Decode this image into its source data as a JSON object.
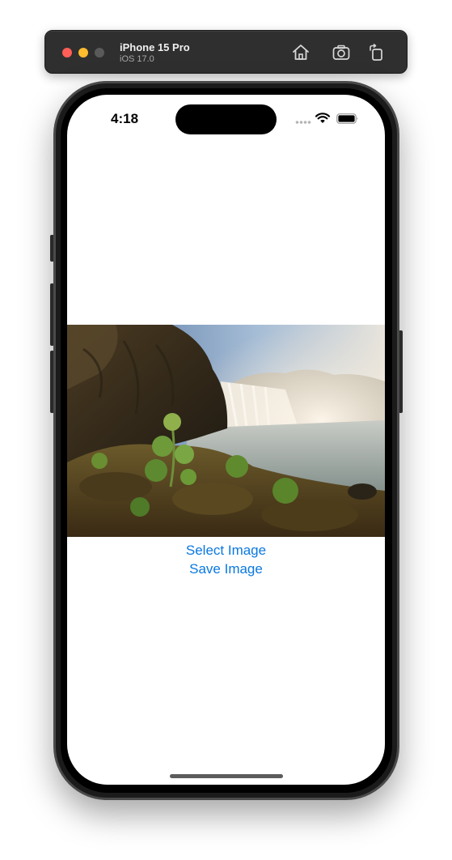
{
  "simulator": {
    "device_name": "iPhone 15 Pro",
    "os_version": "iOS 17.0",
    "toolbar_icons": [
      "home-icon",
      "screenshot-icon",
      "rotate-icon"
    ]
  },
  "status_bar": {
    "time": "4:18",
    "icons": [
      "signal-dots-icon",
      "wifi-icon",
      "battery-icon"
    ]
  },
  "content": {
    "image_subject": "waterfall landscape photo",
    "select_image_label": "Select Image",
    "save_image_label": "Save Image",
    "link_color": "#0a78e0"
  }
}
